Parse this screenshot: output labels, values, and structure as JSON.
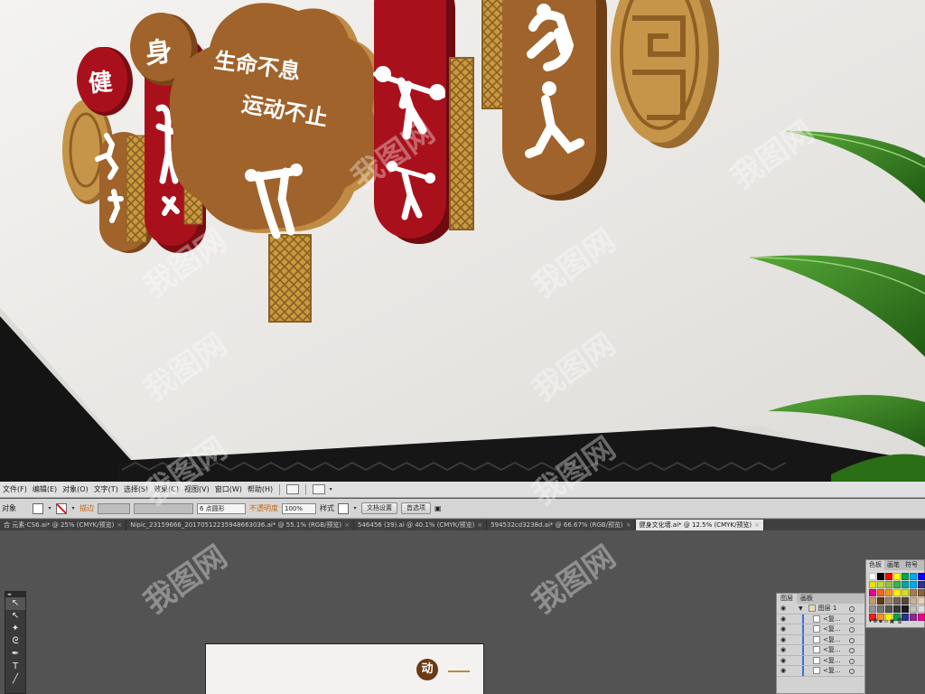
{
  "scene": {
    "badges": [
      "健",
      "身"
    ],
    "slogan_line1": "生命不息",
    "slogan_line2": "运动不止"
  },
  "menubar": {
    "items": [
      "文件(F)",
      "编辑(E)",
      "对象(O)",
      "文字(T)",
      "选择(S)",
      "效果(C)",
      "视图(V)",
      "窗口(W)",
      "帮助(H)"
    ]
  },
  "controlbar": {
    "object_label": "对象",
    "stroke_label": "描边",
    "point_label": "6 点圆形",
    "opacity_label": "不透明度",
    "opacity_value": "100%",
    "style_label": "样式",
    "doc_setup_button": "文档设置",
    "preferences_button": "首选项"
  },
  "tabs": [
    {
      "label": "合 元素-CS6.ai* @ 25% (CMYK/预览)",
      "active": false
    },
    {
      "label": "Nipic_23159666_20170512235948663036.ai* @ 55.1% (RGB/预览)",
      "active": false
    },
    {
      "label": "546456 (39).ai @ 40.1% (CMYK/预览)",
      "active": false
    },
    {
      "label": "594532cd3238d.ai* @ 66.67% (RGB/预览)",
      "active": false
    },
    {
      "label": "健身文化墙.ai* @ 12.5% (CMYK/预览)",
      "active": true
    }
  ],
  "toolbox": {
    "tools": [
      {
        "icon": "selection-tool-icon",
        "glyph": "↖",
        "selected": true
      },
      {
        "icon": "direct-selection-tool-icon",
        "glyph": "↖",
        "selected": false
      },
      {
        "icon": "magic-wand-tool-icon",
        "glyph": "✦",
        "selected": false
      },
      {
        "icon": "lasso-tool-icon",
        "glyph": "ᘓ",
        "selected": false
      },
      {
        "icon": "pen-tool-icon",
        "glyph": "✒",
        "selected": false
      },
      {
        "icon": "type-tool-icon",
        "glyph": "T",
        "selected": false
      },
      {
        "icon": "line-tool-icon",
        "glyph": "╱",
        "selected": false
      }
    ]
  },
  "artboard": {
    "badge_text": "动"
  },
  "swatches": {
    "tabs": [
      "色板",
      "画笔",
      "符号"
    ],
    "colors": [
      "#ffffff",
      "#000000",
      "#ff0000",
      "#ffff00",
      "#00a650",
      "#00aeef",
      "#0000ff",
      "#e4e400",
      "#bfd730",
      "#8cc63f",
      "#39b54a",
      "#00a99d",
      "#00aeef",
      "#2e3192",
      "#ec008c",
      "#f26522",
      "#f7941d",
      "#fff200",
      "#d7df23",
      "#a67c52",
      "#8c6239",
      "#c69c6d",
      "#603913",
      "#998675",
      "#736357",
      "#534741",
      "#c7b299",
      "#e6d2b5",
      "#959595",
      "#747474",
      "#545454",
      "#363636",
      "#1a1a1a",
      "#c2c2c2",
      "#e0e0e0",
      "#ed1c24",
      "#f7941d",
      "#fff200",
      "#00a651",
      "#2e3192",
      "#92278f",
      "#ec008c"
    ],
    "footer": "▾ 𝄜 ▪ ▫ ▣ 🗑"
  },
  "layers": {
    "tabs": [
      "图层",
      "画板"
    ],
    "top_layer": "图层 1",
    "sublayer_label": "<复...",
    "sublayer_count": 6
  },
  "watermark": {
    "text": "我图网",
    "color": "#ffffff"
  },
  "colors": {
    "wood": "#a0632b",
    "wood_dark": "#7a4518",
    "red": "#a8111b",
    "gold": "#c89a52",
    "wall": "#eae8e5",
    "floor": "#151515",
    "leaf": "#2f7d1c"
  }
}
